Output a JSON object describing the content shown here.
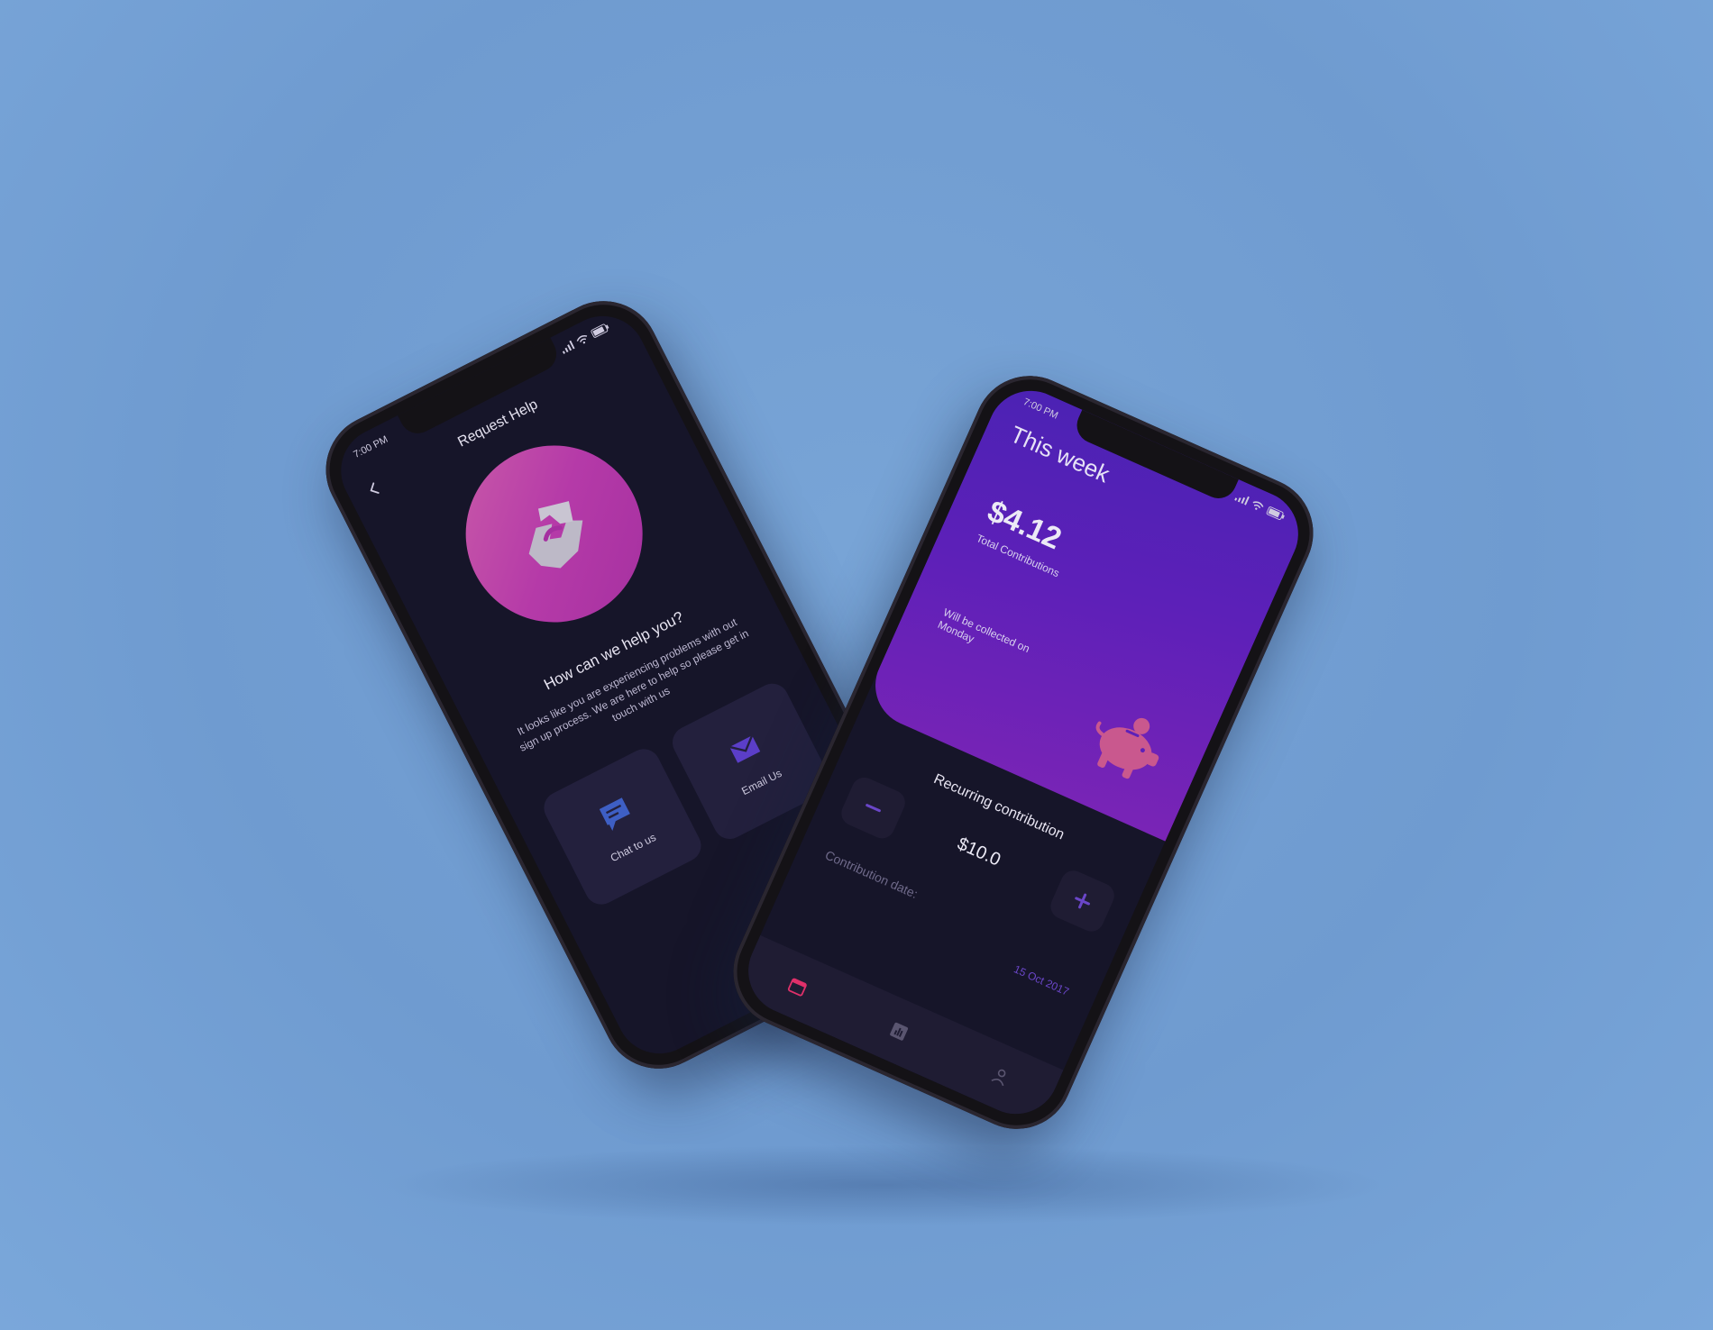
{
  "left_phone": {
    "status_time": "7:00 PM",
    "title": "Request Help",
    "question": "How can we help you?",
    "description": "It looks like you are experiencing problems with out sign up process. We are here to help so please get in touch with us",
    "actions": [
      {
        "label": "Chat to us",
        "icon": "chat-icon"
      },
      {
        "label": "Email Us",
        "icon": "mail-icon"
      }
    ],
    "hero_icon": "handshake-icon",
    "colors": {
      "hero_start": "#c95aa8",
      "hero_end": "#a530a0",
      "chat_icon": "#3e5fc4",
      "mail_icon": "#5b3ec8"
    }
  },
  "right_phone": {
    "status_time": "7:00 PM",
    "title": "This week",
    "total_amount": "$4.12",
    "total_label": "Total Contributions",
    "collection_note": "Will be collected on Monday",
    "recurring_label": "Recurring contribution",
    "recurring_value": "$10.0",
    "date_label": "Contribution date:",
    "date_value": "15 Oct 2017",
    "hero_icon": "piggy-bank-icon",
    "tabs": [
      {
        "icon": "calendar-icon",
        "active": true
      },
      {
        "icon": "chart-icon",
        "active": false
      },
      {
        "icon": "profile-icon",
        "active": false
      }
    ],
    "colors": {
      "panel_start": "#4b22b4",
      "panel_end": "#7a24b6",
      "accent": "#6a46c8",
      "active_tab": "#e0306a"
    }
  }
}
